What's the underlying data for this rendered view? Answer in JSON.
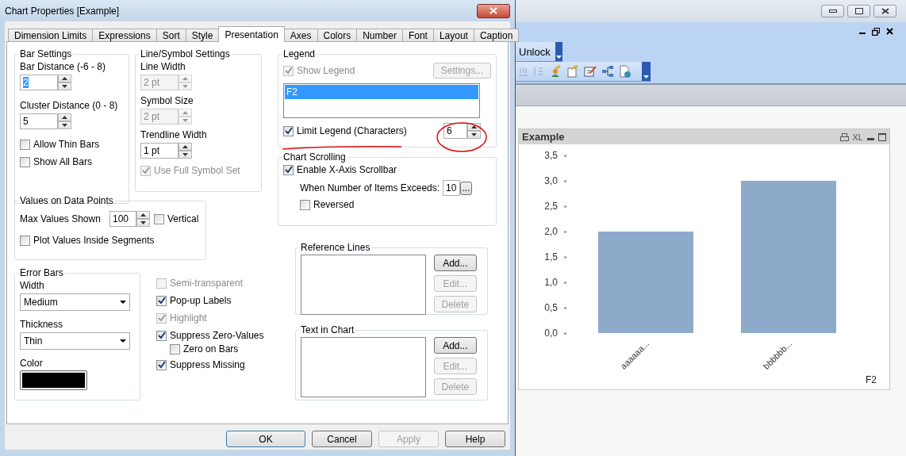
{
  "dialog": {
    "title": "Chart Properties [Example]",
    "tabs": [
      {
        "label": "Dimension Limits",
        "selected": false
      },
      {
        "label": "Expressions",
        "selected": false
      },
      {
        "label": "Sort",
        "selected": false
      },
      {
        "label": "Style",
        "selected": false
      },
      {
        "label": "Presentation",
        "selected": true
      },
      {
        "label": "Axes",
        "selected": false
      },
      {
        "label": "Colors",
        "selected": false
      },
      {
        "label": "Number",
        "selected": false
      },
      {
        "label": "Font",
        "selected": false
      },
      {
        "label": "Layout",
        "selected": false
      },
      {
        "label": "Caption",
        "selected": false
      }
    ],
    "bar_settings": {
      "title": "Bar Settings",
      "spinners": [
        {
          "label": "Bar Distance (-6 - 8)",
          "value": "2",
          "highlighted": true,
          "disabled": false
        },
        {
          "label": "Cluster Distance (0 - 8)",
          "value": "5",
          "highlighted": false,
          "disabled": false
        }
      ],
      "checkboxes": [
        {
          "label": "Allow Thin Bars",
          "checked": false,
          "disabled": false
        },
        {
          "label": "Show All Bars",
          "checked": false,
          "disabled": false
        }
      ]
    },
    "line_symbol_settings": {
      "title": "Line/Symbol Settings",
      "spinners": [
        {
          "label": "Line Width",
          "value": "2 pt",
          "highlighted": false,
          "disabled": true
        },
        {
          "label": "Symbol Size",
          "value": "2 pt",
          "highlighted": false,
          "disabled": true
        },
        {
          "label": "Trendline Width",
          "value": "1 pt",
          "highlighted": false,
          "disabled": false
        }
      ],
      "checkboxes": [
        {
          "label": "Use Full Symbol Set",
          "checked": true,
          "disabled": true
        }
      ]
    },
    "values_on_data_points": {
      "title": "Values on Data Points",
      "max_label": "Max Values Shown",
      "max_value": "100",
      "vertical": {
        "label": "Vertical",
        "checked": false,
        "disabled": false
      },
      "inside": {
        "label": "Plot Values Inside Segments",
        "checked": false,
        "disabled": false
      }
    },
    "error_bars": {
      "title": "Error Bars",
      "dropdowns": [
        {
          "label": "Width",
          "value": "Medium"
        },
        {
          "label": "Thickness",
          "value": "Thin"
        }
      ],
      "color_label": "Color",
      "color": "#000000"
    },
    "options": [
      {
        "label": "Semi-transparent",
        "checked": false,
        "disabled": true
      },
      {
        "label": "Pop-up Labels",
        "checked": true,
        "disabled": false
      },
      {
        "label": "Highlight",
        "checked": true,
        "disabled": true
      },
      {
        "label": "Suppress Zero-Values",
        "checked": true,
        "disabled": false,
        "children": [
          {
            "label": "Zero on Bars",
            "checked": false,
            "disabled": false
          }
        ]
      },
      {
        "label": "Suppress Missing",
        "checked": true,
        "disabled": false
      }
    ],
    "legend": {
      "title": "Legend",
      "show_legend": {
        "label": "Show Legend",
        "checked": true,
        "disabled": true
      },
      "settings_button": {
        "label": "Settings...",
        "disabled": true
      },
      "items": [
        {
          "label": "F2",
          "selected": true
        }
      ],
      "limit_legend": {
        "label": "Limit Legend (Characters)",
        "checked": true,
        "disabled": false
      },
      "limit_value": "6"
    },
    "chart_scrolling": {
      "title": "Chart Scrolling",
      "enable": {
        "label": "Enable X-Axis Scrollbar",
        "checked": true,
        "disabled": false
      },
      "items_label": "When Number of Items Exceeds:",
      "items_value": "10",
      "browse_button": "...",
      "reversed": {
        "label": "Reversed",
        "checked": false,
        "disabled": false
      }
    },
    "reference_lines": {
      "title": "Reference Lines",
      "buttons": [
        {
          "label": "Add...",
          "disabled": false
        },
        {
          "label": "Edit...",
          "disabled": true
        },
        {
          "label": "Delete",
          "disabled": true
        }
      ]
    },
    "text_in_chart": {
      "title": "Text in Chart",
      "buttons": [
        {
          "label": "Add...",
          "disabled": false
        },
        {
          "label": "Edit...",
          "disabled": true
        },
        {
          "label": "Delete",
          "disabled": true
        }
      ]
    },
    "footer_buttons": [
      {
        "label": "OK",
        "disabled": false,
        "default": true
      },
      {
        "label": "Cancel",
        "disabled": false,
        "default": false
      },
      {
        "label": "Apply",
        "disabled": true,
        "default": false
      },
      {
        "label": "Help",
        "disabled": false,
        "default": false
      }
    ]
  },
  "app": {
    "toolbar_button": "Unlock",
    "chart_window": {
      "title": "Example",
      "caption_text": "XL",
      "chart_data": {
        "type": "bar",
        "categories": [
          "aaaaaa...",
          "bbbbbb..."
        ],
        "series": [
          {
            "name": "F2",
            "color": "#8eaacb",
            "values": [
              2,
              3
            ]
          }
        ],
        "ylim": [
          0,
          3.5
        ],
        "yticks": [
          {
            "value": 0,
            "label": "0,0"
          },
          {
            "value": 0.5,
            "label": "0,5"
          },
          {
            "value": 1,
            "label": "1,0"
          },
          {
            "value": 1.5,
            "label": "1,5"
          },
          {
            "value": 2,
            "label": "2,0"
          },
          {
            "value": 2.5,
            "label": "2,5"
          },
          {
            "value": 3,
            "label": "3,0"
          },
          {
            "value": 3.5,
            "label": "3,5"
          }
        ]
      }
    }
  }
}
